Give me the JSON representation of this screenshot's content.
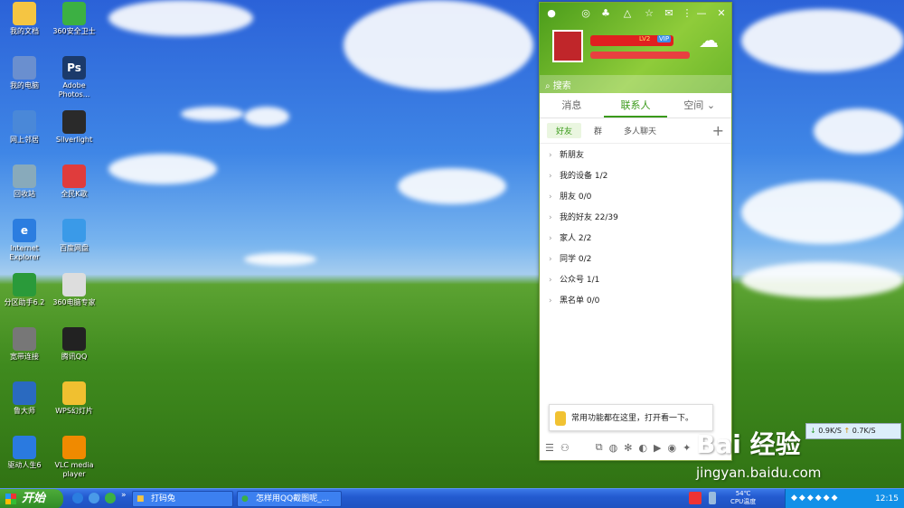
{
  "desktop": {
    "icons": [
      {
        "label": "我的文档",
        "color": "#f5c542",
        "glyph": "folder-icon"
      },
      {
        "label": "360安全卫士",
        "color": "#3cb043",
        "glyph": "shield-icon"
      },
      {
        "label": "我的电脑",
        "color": "#6a8fcf",
        "glyph": "computer-icon"
      },
      {
        "label": "Adobe Photos...",
        "color": "#1b3a6b",
        "glyph": "photoshop-icon",
        "text": "Ps"
      },
      {
        "label": "网上邻居",
        "color": "#4a88d8",
        "glyph": "network-icon"
      },
      {
        "label": "Silverlight",
        "color": "#2a2a2a",
        "glyph": "window-icon"
      },
      {
        "label": "回收站",
        "color": "#8ab",
        "glyph": "recycle-bin-icon"
      },
      {
        "label": "全民K歌",
        "color": "#e03c3c",
        "glyph": "microphone-icon"
      },
      {
        "label": "Internet Explorer",
        "color": "#2b7de0",
        "glyph": "ie-icon",
        "text": "e"
      },
      {
        "label": "百度网盘",
        "color": "#3a9ae8",
        "glyph": "cloud-drive-icon"
      },
      {
        "label": "分区助手6.2",
        "color": "#2a9a3a",
        "glyph": "disk-icon"
      },
      {
        "label": "360电脑专家",
        "color": "#ddd",
        "glyph": "expert-icon"
      },
      {
        "label": "宽带连接",
        "color": "#777",
        "glyph": "broadband-icon"
      },
      {
        "label": "腾讯QQ",
        "color": "#222",
        "glyph": "qq-penguin-icon"
      },
      {
        "label": "鲁大师",
        "color": "#2a6ac0",
        "glyph": "ludashi-icon"
      },
      {
        "label": "WPS幻灯片",
        "color": "#f0c030",
        "glyph": "folder-icon"
      },
      {
        "label": "驱动人生6",
        "color": "#2a7ae0",
        "glyph": "driver-icon"
      },
      {
        "label": "VLC media player",
        "color": "#f08a00",
        "glyph": "vlc-cone-icon"
      }
    ]
  },
  "qq": {
    "search_placeholder": "搜索",
    "tabs": [
      {
        "label": "消息"
      },
      {
        "label": "联系人"
      },
      {
        "label": "空间"
      }
    ],
    "subtabs": [
      {
        "label": "好友"
      },
      {
        "label": "群"
      },
      {
        "label": "多人聊天"
      }
    ],
    "add_label": "+",
    "badge1": "LV2",
    "badge2": "VIP",
    "groups": [
      {
        "name": "新朋友",
        "count": ""
      },
      {
        "name": "我的设备",
        "count": "1/2"
      },
      {
        "name": "朋友",
        "count": "0/0"
      },
      {
        "name": "我的好友",
        "count": "22/39"
      },
      {
        "name": "家人",
        "count": "2/2"
      },
      {
        "name": "同学",
        "count": "0/2"
      },
      {
        "name": "公众号",
        "count": "1/1"
      },
      {
        "name": "黑名单",
        "count": "0/0"
      }
    ],
    "tip": "常用功能都在这里，打开看一下。"
  },
  "widgets": {
    "net_down": "0.9K/S",
    "net_up": "0.7K/S",
    "watermark_brand": "Bai 经验",
    "watermark_site": "jingyan.baidu.com"
  },
  "taskbar": {
    "start_label": "开始",
    "tasks": [
      {
        "label": "打码兔"
      },
      {
        "label": "怎样用QQ截图呢_..."
      }
    ],
    "cpu_temp": "54℃",
    "cpu_label": "CPU温度",
    "clock": "12:15"
  }
}
